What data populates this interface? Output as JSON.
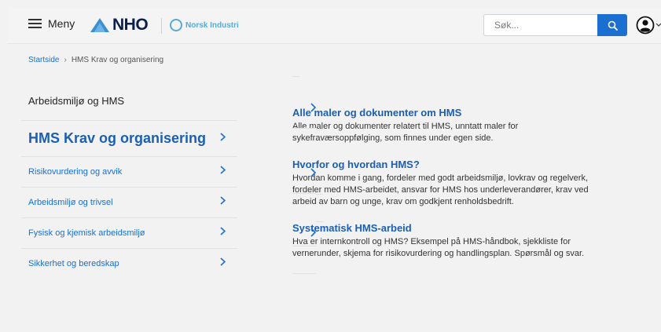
{
  "header": {
    "menu_label": "Meny",
    "logo_text": "NHO",
    "partner_logo_text": "Norsk Industri",
    "search_placeholder": "Søk...",
    "icons": {
      "menu": "hamburger-icon",
      "search": "search-icon",
      "user": "user-icon",
      "dropdown": "chevron-down-icon"
    }
  },
  "breadcrumb": {
    "home": "Startside",
    "current": "HMS Krav og organisering"
  },
  "sidebar": {
    "title": "Arbeidsmiljø og HMS",
    "items": [
      {
        "label": "HMS Krav og organisering",
        "active": true
      },
      {
        "label": "Risikovurdering og avvik"
      },
      {
        "label": "Arbeidsmiljø og trivsel"
      },
      {
        "label": "Fysisk og kjemisk arbeidsmiljø"
      },
      {
        "label": "Sikkerhet og beredskap"
      }
    ]
  },
  "content": {
    "cards": [
      {
        "title": "Alle maler og dokumenter om HMS",
        "description": "Alle maler og dokumenter relatert til HMS, unntatt maler for sykefraværsoppfølging, som finnes under egen side."
      },
      {
        "title": "Hvorfor og hvordan HMS?",
        "description": "Hvordan komme i gang, fordeler med godt arbeidsmiljø, lovkrav og regelverk, fordeler med HMS-arbeidet, ansvar for HMS hos underleverandører, krav ved arbeid av barn og unge, krav om godkjent renholdsbedrift."
      },
      {
        "title": "Systematisk HMS-arbeid",
        "description": "Hva er internkontroll og HMS? Eksempel på HMS-håndbok, sjekkliste for vernerunder, skjema for risikovurdering og handlingsplan. Spørsmål og svar."
      }
    ]
  },
  "colors": {
    "accent": "#1a6fd1",
    "link": "#1a5fb4",
    "brand_dark": "#0b1e4d",
    "partner": "#5aa9d6"
  }
}
